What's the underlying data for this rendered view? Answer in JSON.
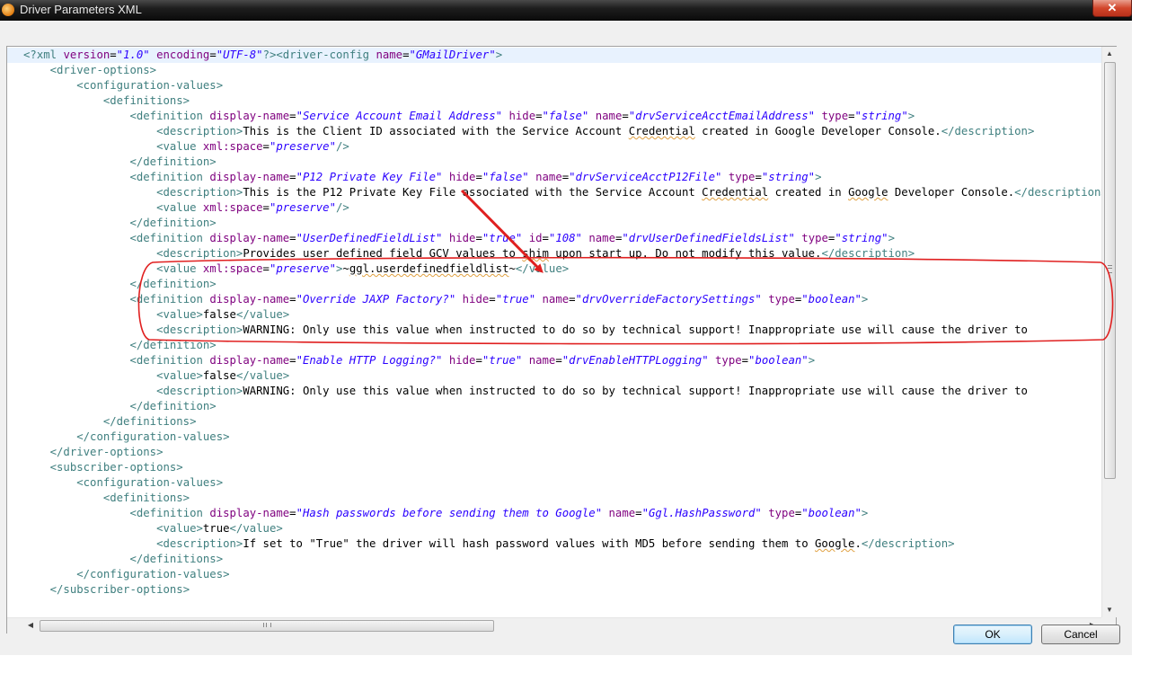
{
  "window": {
    "title": "Driver Parameters XML",
    "close_label": "✕"
  },
  "editor": {
    "lines": [
      [
        [
          "t",
          "<?"
        ],
        [
          "t",
          "xml "
        ],
        [
          "a",
          "version"
        ],
        [
          "x",
          "="
        ],
        [
          "v",
          "\"1.0\""
        ],
        [
          "x",
          " "
        ],
        [
          "a",
          "encoding"
        ],
        [
          "x",
          "="
        ],
        [
          "v",
          "\"UTF-8\""
        ],
        [
          "t",
          "?>"
        ],
        [
          "t",
          "<driver-config "
        ],
        [
          "a",
          "name"
        ],
        [
          "x",
          "="
        ],
        [
          "v",
          "\"GMailDriver\""
        ],
        [
          "t",
          ">"
        ]
      ],
      [
        [
          "x",
          "    "
        ],
        [
          "t",
          "<driver-options>"
        ]
      ],
      [
        [
          "x",
          "        "
        ],
        [
          "t",
          "<configuration-values>"
        ]
      ],
      [
        [
          "x",
          "            "
        ],
        [
          "t",
          "<definitions>"
        ]
      ],
      [
        [
          "x",
          "                "
        ],
        [
          "t",
          "<definition "
        ],
        [
          "a",
          "display-name"
        ],
        [
          "x",
          "="
        ],
        [
          "v",
          "\"Service Account Email Address\""
        ],
        [
          "x",
          " "
        ],
        [
          "a",
          "hide"
        ],
        [
          "x",
          "="
        ],
        [
          "v",
          "\"false\""
        ],
        [
          "x",
          " "
        ],
        [
          "a",
          "name"
        ],
        [
          "x",
          "="
        ],
        [
          "v",
          "\"drvServiceAcctEmailAddress\""
        ],
        [
          "x",
          " "
        ],
        [
          "a",
          "type"
        ],
        [
          "x",
          "="
        ],
        [
          "v",
          "\"string\""
        ],
        [
          "t",
          ">"
        ]
      ],
      [
        [
          "x",
          "                    "
        ],
        [
          "t",
          "<description>"
        ],
        [
          "x",
          "This is the Client ID associated with the Service Account "
        ],
        [
          "s",
          "Credential"
        ],
        [
          "x",
          " created in Google Developer Console."
        ],
        [
          "t",
          "</description>"
        ]
      ],
      [
        [
          "x",
          "                    "
        ],
        [
          "t",
          "<value "
        ],
        [
          "a",
          "xml:space"
        ],
        [
          "x",
          "="
        ],
        [
          "v",
          "\"preserve\""
        ],
        [
          "t",
          "/>"
        ]
      ],
      [
        [
          "x",
          "                "
        ],
        [
          "t",
          "</definition>"
        ]
      ],
      [
        [
          "x",
          "                "
        ],
        [
          "t",
          "<definition "
        ],
        [
          "a",
          "display-name"
        ],
        [
          "x",
          "="
        ],
        [
          "v",
          "\"P12 Private Key File\""
        ],
        [
          "x",
          " "
        ],
        [
          "a",
          "hide"
        ],
        [
          "x",
          "="
        ],
        [
          "v",
          "\"false\""
        ],
        [
          "x",
          " "
        ],
        [
          "a",
          "name"
        ],
        [
          "x",
          "="
        ],
        [
          "v",
          "\"drvServiceAcctP12File\""
        ],
        [
          "x",
          " "
        ],
        [
          "a",
          "type"
        ],
        [
          "x",
          "="
        ],
        [
          "v",
          "\"string\""
        ],
        [
          "t",
          ">"
        ]
      ],
      [
        [
          "x",
          "                    "
        ],
        [
          "t",
          "<description>"
        ],
        [
          "x",
          "This is the P12 Private Key File associated with the Service Account "
        ],
        [
          "s",
          "Credential"
        ],
        [
          "x",
          " created in "
        ],
        [
          "s",
          "Google"
        ],
        [
          "x",
          " Developer Console."
        ],
        [
          "t",
          "</description>"
        ]
      ],
      [
        [
          "x",
          "                    "
        ],
        [
          "t",
          "<value "
        ],
        [
          "a",
          "xml:space"
        ],
        [
          "x",
          "="
        ],
        [
          "v",
          "\"preserve\""
        ],
        [
          "t",
          "/>"
        ]
      ],
      [
        [
          "x",
          "                "
        ],
        [
          "t",
          "</definition>"
        ]
      ],
      [
        [
          "x",
          "                "
        ],
        [
          "t",
          "<definition "
        ],
        [
          "a",
          "display-name"
        ],
        [
          "x",
          "="
        ],
        [
          "v",
          "\"UserDefinedFieldList\""
        ],
        [
          "x",
          " "
        ],
        [
          "a",
          "hide"
        ],
        [
          "x",
          "="
        ],
        [
          "v",
          "\"true\""
        ],
        [
          "x",
          " "
        ],
        [
          "a",
          "id"
        ],
        [
          "x",
          "="
        ],
        [
          "v",
          "\"108\""
        ],
        [
          "x",
          " "
        ],
        [
          "a",
          "name"
        ],
        [
          "x",
          "="
        ],
        [
          "v",
          "\"drvUserDefinedFieldsList\""
        ],
        [
          "x",
          " "
        ],
        [
          "a",
          "type"
        ],
        [
          "x",
          "="
        ],
        [
          "v",
          "\"string\""
        ],
        [
          "t",
          ">"
        ]
      ],
      [
        [
          "x",
          "                    "
        ],
        [
          "t",
          "<description>"
        ],
        [
          "x",
          "Provides user defined field GCV values to "
        ],
        [
          "s",
          "shim"
        ],
        [
          "x",
          " upon start up. Do not modify this value."
        ],
        [
          "t",
          "</description>"
        ]
      ],
      [
        [
          "x",
          "                    "
        ],
        [
          "t",
          "<value "
        ],
        [
          "a",
          "xml:space"
        ],
        [
          "x",
          "="
        ],
        [
          "v",
          "\"preserve\""
        ],
        [
          "t",
          ">"
        ],
        [
          "x",
          "~"
        ],
        [
          "s",
          "ggl.userdefinedfieldlist"
        ],
        [
          "x",
          "~"
        ],
        [
          "t",
          "</value>"
        ]
      ],
      [
        [
          "x",
          "                "
        ],
        [
          "t",
          "</definition>"
        ]
      ],
      [
        [
          "x",
          "                "
        ],
        [
          "t",
          "<definition "
        ],
        [
          "a",
          "display-name"
        ],
        [
          "x",
          "="
        ],
        [
          "v",
          "\"Override JAXP Factory?\""
        ],
        [
          "x",
          " "
        ],
        [
          "a",
          "hide"
        ],
        [
          "x",
          "="
        ],
        [
          "v",
          "\"true\""
        ],
        [
          "x",
          " "
        ],
        [
          "a",
          "name"
        ],
        [
          "x",
          "="
        ],
        [
          "v",
          "\"drvOverrideFactorySettings\""
        ],
        [
          "x",
          " "
        ],
        [
          "a",
          "type"
        ],
        [
          "x",
          "="
        ],
        [
          "v",
          "\"boolean\""
        ],
        [
          "t",
          ">"
        ]
      ],
      [
        [
          "x",
          "                    "
        ],
        [
          "t",
          "<value>"
        ],
        [
          "x",
          "false"
        ],
        [
          "t",
          "</value>"
        ]
      ],
      [
        [
          "x",
          "                    "
        ],
        [
          "t",
          "<description>"
        ],
        [
          "x",
          "WARNING: Only use this value when instructed to do so by technical support! Inappropriate use will cause the driver to"
        ]
      ],
      [
        [
          "x",
          "                "
        ],
        [
          "t",
          "</definition>"
        ]
      ],
      [
        [
          "x",
          "                "
        ],
        [
          "t",
          "<definition "
        ],
        [
          "a",
          "display-name"
        ],
        [
          "x",
          "="
        ],
        [
          "v",
          "\"Enable HTTP Logging?\""
        ],
        [
          "x",
          " "
        ],
        [
          "a",
          "hide"
        ],
        [
          "x",
          "="
        ],
        [
          "v",
          "\"true\""
        ],
        [
          "x",
          " "
        ],
        [
          "a",
          "name"
        ],
        [
          "x",
          "="
        ],
        [
          "v",
          "\"drvEnableHTTPLogging\""
        ],
        [
          "x",
          " "
        ],
        [
          "a",
          "type"
        ],
        [
          "x",
          "="
        ],
        [
          "v",
          "\"boolean\""
        ],
        [
          "t",
          ">"
        ]
      ],
      [
        [
          "x",
          "                    "
        ],
        [
          "t",
          "<value>"
        ],
        [
          "x",
          "false"
        ],
        [
          "t",
          "</value>"
        ]
      ],
      [
        [
          "x",
          "                    "
        ],
        [
          "t",
          "<description>"
        ],
        [
          "x",
          "WARNING: Only use this value when instructed to do so by technical support! Inappropriate use will cause the driver to"
        ]
      ],
      [
        [
          "x",
          "                "
        ],
        [
          "t",
          "</definition>"
        ]
      ],
      [
        [
          "x",
          "            "
        ],
        [
          "t",
          "</definitions>"
        ]
      ],
      [
        [
          "x",
          "        "
        ],
        [
          "t",
          "</configuration-values>"
        ]
      ],
      [
        [
          "x",
          "    "
        ],
        [
          "t",
          "</driver-options>"
        ]
      ],
      [
        [
          "x",
          "    "
        ],
        [
          "t",
          "<subscriber-options>"
        ]
      ],
      [
        [
          "x",
          "        "
        ],
        [
          "t",
          "<configuration-values>"
        ]
      ],
      [
        [
          "x",
          "            "
        ],
        [
          "t",
          "<definitions>"
        ]
      ],
      [
        [
          "x",
          "                "
        ],
        [
          "t",
          "<definition "
        ],
        [
          "a",
          "display-name"
        ],
        [
          "x",
          "="
        ],
        [
          "v",
          "\"Hash passwords before sending them to Google\""
        ],
        [
          "x",
          " "
        ],
        [
          "a",
          "name"
        ],
        [
          "x",
          "="
        ],
        [
          "v",
          "\"Ggl.HashPassword\""
        ],
        [
          "x",
          " "
        ],
        [
          "a",
          "type"
        ],
        [
          "x",
          "="
        ],
        [
          "v",
          "\"boolean\""
        ],
        [
          "t",
          ">"
        ]
      ],
      [
        [
          "x",
          "                    "
        ],
        [
          "t",
          "<value>"
        ],
        [
          "x",
          "true"
        ],
        [
          "t",
          "</value>"
        ]
      ],
      [
        [
          "x",
          "                    "
        ],
        [
          "t",
          "<description>"
        ],
        [
          "x",
          "If set to \"True\" the driver will hash password values with MD5 before sending them to "
        ],
        [
          "s",
          "Google"
        ],
        [
          "x",
          "."
        ],
        [
          "t",
          "</description>"
        ]
      ],
      [
        [
          "x",
          "                "
        ],
        [
          "t",
          "</definitions>"
        ]
      ],
      [
        [
          "x",
          "        "
        ],
        [
          "t",
          "</configuration-values>"
        ]
      ],
      [
        [
          "x",
          "    "
        ],
        [
          "t",
          "</subscriber-options>"
        ]
      ]
    ]
  },
  "scrollbars": {
    "vertical_up_icon": "▲",
    "vertical_down_icon": "▼",
    "horizontal_left_icon": "◀",
    "horizontal_right_icon": "▶"
  },
  "buttons": {
    "ok_label": "OK",
    "cancel_label": "Cancel"
  },
  "annotation": {
    "color": "#e02020"
  }
}
